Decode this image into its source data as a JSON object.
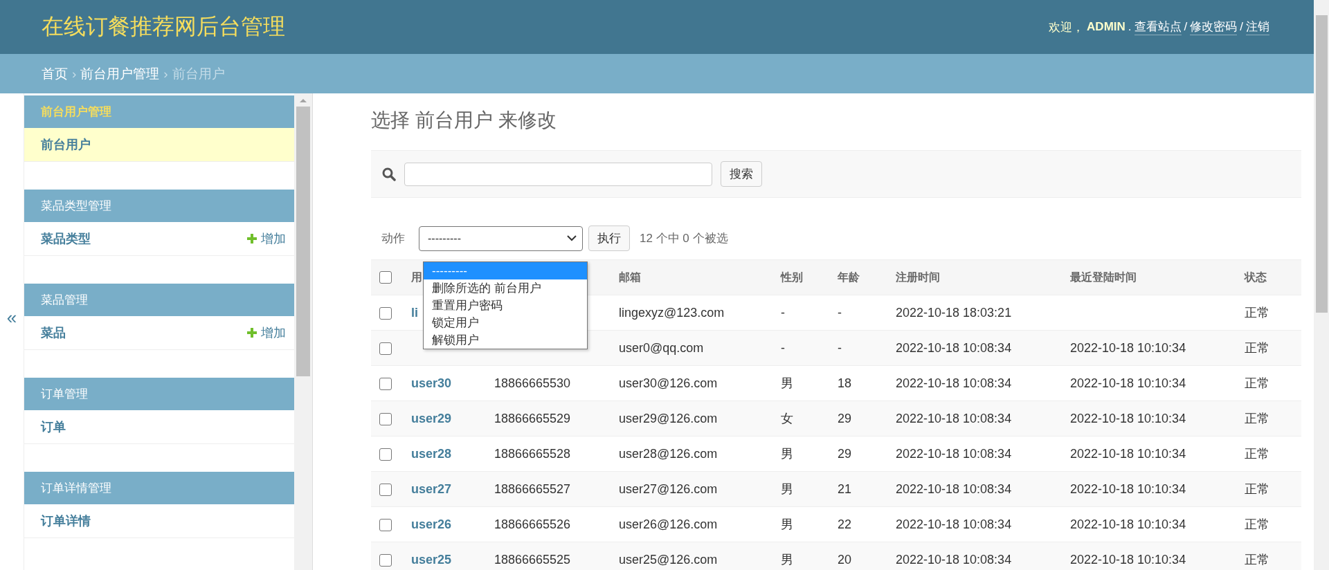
{
  "header": {
    "title": "在线订餐推荐网后台管理",
    "welcome": "欢迎，",
    "username": "ADMIN",
    "links": [
      {
        "sep": ".",
        "label": "查看站点"
      },
      {
        "sep": "/",
        "label": "修改密码"
      },
      {
        "sep": "/",
        "label": "注销"
      }
    ]
  },
  "breadcrumbs": [
    {
      "label": "首页",
      "kind": "link"
    },
    {
      "sep": "›",
      "label": "前台用户管理",
      "kind": "link"
    },
    {
      "sep": "›",
      "label": "前台用户",
      "kind": "current"
    }
  ],
  "sidebar": {
    "toggle": "«",
    "modules": [
      {
        "caption": "前台用户管理",
        "selected": true,
        "models": [
          {
            "name": "前台用户",
            "selected": true
          }
        ]
      },
      {
        "caption": "菜品类型管理",
        "selected": false,
        "models": [
          {
            "name": "菜品类型",
            "selected": false,
            "add": "增加"
          }
        ]
      },
      {
        "caption": "菜品管理",
        "selected": false,
        "models": [
          {
            "name": "菜品",
            "selected": false,
            "add": "增加"
          }
        ]
      },
      {
        "caption": "订单管理",
        "selected": false,
        "models": [
          {
            "name": "订单",
            "selected": false
          }
        ]
      },
      {
        "caption": "订单详情管理",
        "selected": false,
        "models": [
          {
            "name": "订单详情",
            "selected": false
          }
        ]
      }
    ]
  },
  "page_title": "选择 前台用户 来修改",
  "search": {
    "button": "搜索"
  },
  "actions": {
    "label": "动作",
    "value": "---------",
    "go": "执行",
    "counter": "12 个中 0 个被选",
    "options": [
      {
        "label": "---------",
        "selected": true
      },
      {
        "label": "删除所选的 前台用户",
        "selected": false
      },
      {
        "label": "重置用户密码",
        "selected": false
      },
      {
        "label": "锁定用户",
        "selected": false
      },
      {
        "label": "解锁用户",
        "selected": false
      }
    ]
  },
  "table": {
    "select_all": {
      "checked": false
    },
    "columns": [
      "用",
      "",
      "邮箱",
      "性别",
      "年龄",
      "注册时间",
      "最近登陆时间",
      "状态"
    ],
    "rows": [
      {
        "checked": false,
        "cells": [
          "li",
          "",
          "lingexyz@123.com",
          "-",
          "-",
          "2022-10-18 18:03:21",
          "",
          "正常"
        ]
      },
      {
        "checked": false,
        "cells": [
          "",
          "",
          "user0@qq.com",
          "-",
          "-",
          "2022-10-18 10:08:34",
          "2022-10-18 10:10:34",
          "正常"
        ]
      },
      {
        "checked": false,
        "cells": [
          "user30",
          "18866665530",
          "user30@126.com",
          "男",
          "18",
          "2022-10-18 10:08:34",
          "2022-10-18 10:10:34",
          "正常"
        ]
      },
      {
        "checked": false,
        "cells": [
          "user29",
          "18866665529",
          "user29@126.com",
          "女",
          "29",
          "2022-10-18 10:08:34",
          "2022-10-18 10:10:34",
          "正常"
        ]
      },
      {
        "checked": false,
        "cells": [
          "user28",
          "18866665528",
          "user28@126.com",
          "男",
          "29",
          "2022-10-18 10:08:34",
          "2022-10-18 10:10:34",
          "正常"
        ]
      },
      {
        "checked": false,
        "cells": [
          "user27",
          "18866665527",
          "user27@126.com",
          "男",
          "21",
          "2022-10-18 10:08:34",
          "2022-10-18 10:10:34",
          "正常"
        ]
      },
      {
        "checked": false,
        "cells": [
          "user26",
          "18866665526",
          "user26@126.com",
          "男",
          "22",
          "2022-10-18 10:08:34",
          "2022-10-18 10:10:34",
          "正常"
        ]
      },
      {
        "checked": false,
        "cells": [
          "user25",
          "18866665525",
          "user25@126.com",
          "男",
          "20",
          "2022-10-18 10:08:34",
          "2022-10-18 10:10:34",
          "正常"
        ]
      }
    ]
  }
}
